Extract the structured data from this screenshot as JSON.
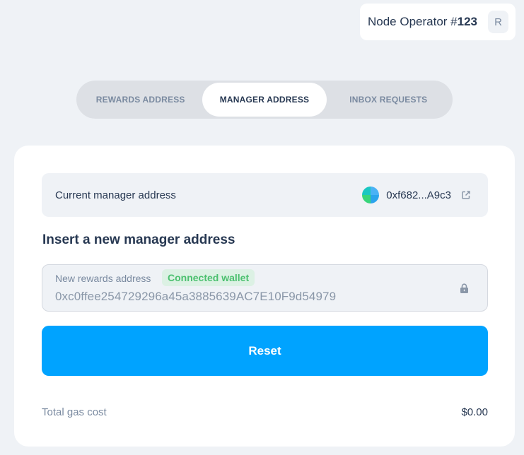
{
  "header": {
    "operator_label": "Node Operator #",
    "operator_id": "123",
    "avatar_initial": "R"
  },
  "tabs": [
    {
      "label": "REWARDS ADDRESS",
      "active": false
    },
    {
      "label": "MANAGER ADDRESS",
      "active": true
    },
    {
      "label": "INBOX REQUESTS",
      "active": false
    }
  ],
  "card": {
    "current_label": "Current manager address",
    "current_address": "0xf682...A9c3",
    "section_title": "Insert a new manager address",
    "field": {
      "label": "New rewards address",
      "badge": "Connected wallet",
      "value": "0xc0ffee254729296a45a3885639AC7E10F9d54979"
    },
    "reset_label": "Reset",
    "gas_label": "Total gas cost",
    "gas_value": "$0.00"
  },
  "icons": {
    "external_link": "external-link-icon",
    "lock": "lock-icon",
    "identicon": "identicon"
  },
  "colors": {
    "accent": "#00a3ff",
    "badge_bg": "#dcf1e4",
    "badge_text": "#4bc06f",
    "page_bg": "#eff2f6"
  }
}
